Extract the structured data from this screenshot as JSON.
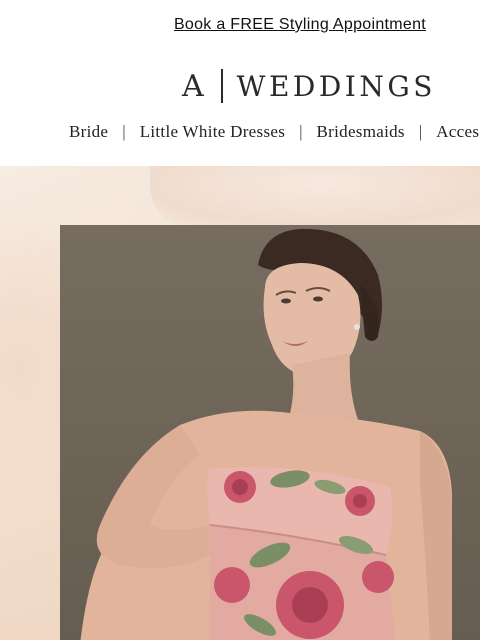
{
  "promo": {
    "text": "Book a FREE Styling Appointment"
  },
  "logo": {
    "mark": "A",
    "word": "WEDDINGS"
  },
  "nav": {
    "items": [
      "Bride",
      "Little White Dresses",
      "Bridesmaids",
      "Acces"
    ]
  },
  "hero": {
    "image": "model-in-floral-strapless-dress"
  },
  "colors": {
    "background": "#ffffff",
    "hero_bg": "#f2dccb",
    "photo_bg": "#6e6558",
    "dress_pink": "#e9b7ad",
    "rose": "#c9566b",
    "leaf": "#7a8f66"
  }
}
